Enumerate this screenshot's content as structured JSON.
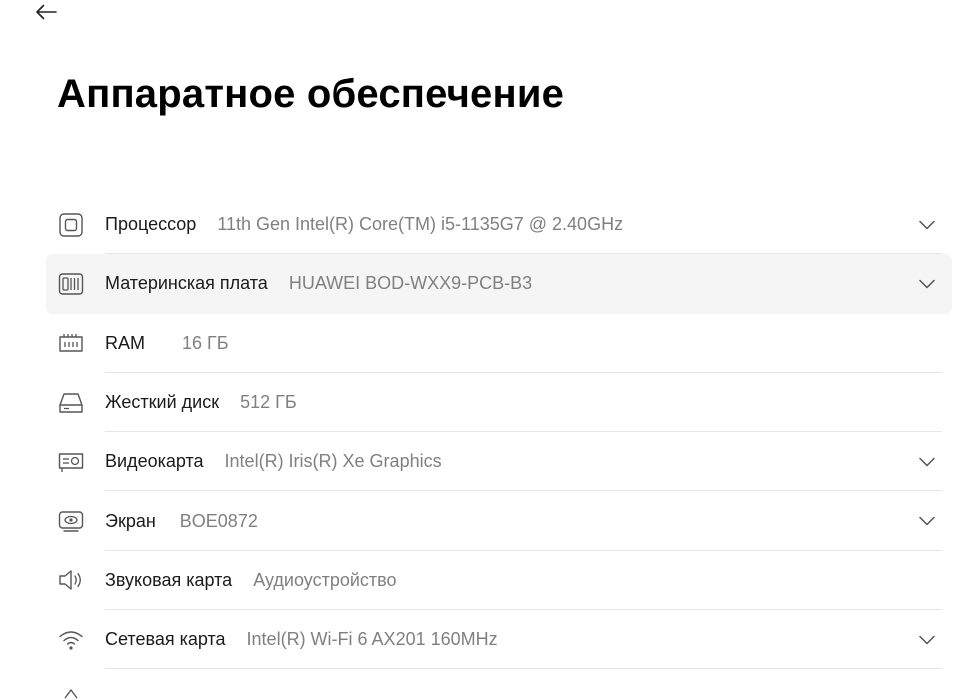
{
  "page": {
    "title": "Аппаратное обеспечение"
  },
  "navigation": {
    "back_icon": "arrow-left-icon"
  },
  "hardware": [
    {
      "id": "processor",
      "icon": "cpu-icon",
      "label": "Процессор",
      "value": "11th Gen Intel(R) Core(TM) i5-1135G7 @ 2.40GHz",
      "expandable": true
    },
    {
      "id": "motherboard",
      "icon": "motherboard-icon",
      "label": "Материнская плата",
      "value": "HUAWEI BOD-WXX9-PCB-B3",
      "expandable": true
    },
    {
      "id": "ram",
      "icon": "ram-icon",
      "label": "RAM",
      "value": "16 ГБ",
      "expandable": false
    },
    {
      "id": "disk",
      "icon": "hard-disk-icon",
      "label": "Жесткий диск",
      "value": "512 ГБ",
      "expandable": false
    },
    {
      "id": "gpu",
      "icon": "graphics-card-icon",
      "label": "Видеокарта",
      "value": "Intel(R) Iris(R) Xe Graphics",
      "expandable": true
    },
    {
      "id": "display",
      "icon": "display-icon",
      "label": "Экран",
      "value": "BOE0872",
      "expandable": true
    },
    {
      "id": "sound",
      "icon": "speaker-icon",
      "label": "Звуковая карта",
      "value": "Аудиоустройство",
      "expandable": false
    },
    {
      "id": "network",
      "icon": "wifi-icon",
      "label": "Сетевая карта",
      "value": "Intel(R) Wi-Fi 6 AX201 160MHz",
      "expandable": true
    }
  ],
  "colors": {
    "selected_row_bg": "#f5f5f5",
    "value_text": "#808080",
    "divider": "#e6e6e6",
    "icon_stroke": "#555555"
  }
}
